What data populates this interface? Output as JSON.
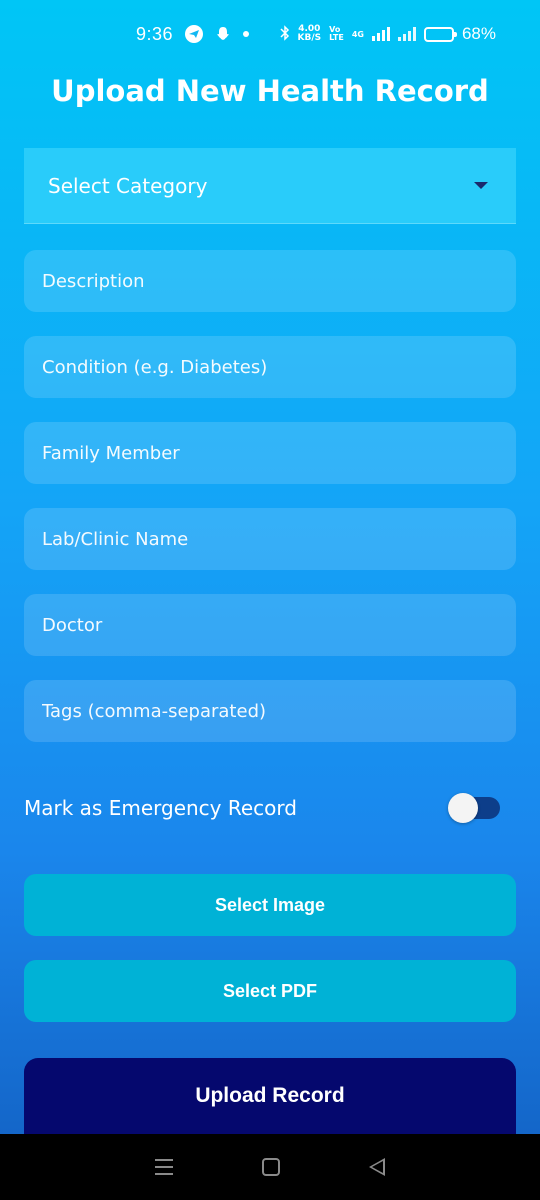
{
  "status_bar": {
    "time": "9:36",
    "icons": [
      "telegram-icon",
      "snapchat-icon",
      "dot-icon",
      "bluetooth-icon",
      "volte-icon",
      "signal-icon",
      "battery-icon"
    ],
    "net_speed_value": "4.00",
    "net_speed_unit": "KB/S",
    "volte_top": "Vo",
    "volte_bottom": "LTE",
    "network_type": "4G",
    "battery_percent": "68%",
    "battery_level": 0.68
  },
  "page": {
    "title": "Upload New Health Record"
  },
  "form": {
    "category_select": {
      "value": "Select Category"
    },
    "fields": {
      "description_placeholder": "Description",
      "condition_placeholder": "Condition (e.g. Diabetes)",
      "family_member_placeholder": "Family Member",
      "lab_clinic_placeholder": "Lab/Clinic Name",
      "doctor_placeholder": "Doctor",
      "tags_placeholder": "Tags (comma-separated)"
    },
    "emergency": {
      "label": "Mark as Emergency Record",
      "enabled": false
    },
    "buttons": {
      "select_image": "Select Image",
      "select_pdf": "Select PDF",
      "upload_record": "Upload Record"
    }
  },
  "colors": {
    "gradient_top": "#00c6f6",
    "gradient_bottom": "#1466c9",
    "secondary_button": "#00b2d6",
    "primary_button": "#05086e",
    "toggle_track": "#0d3e8a"
  },
  "nav_bar": {
    "icons": [
      "menu-icon",
      "home-icon",
      "back-icon"
    ]
  }
}
